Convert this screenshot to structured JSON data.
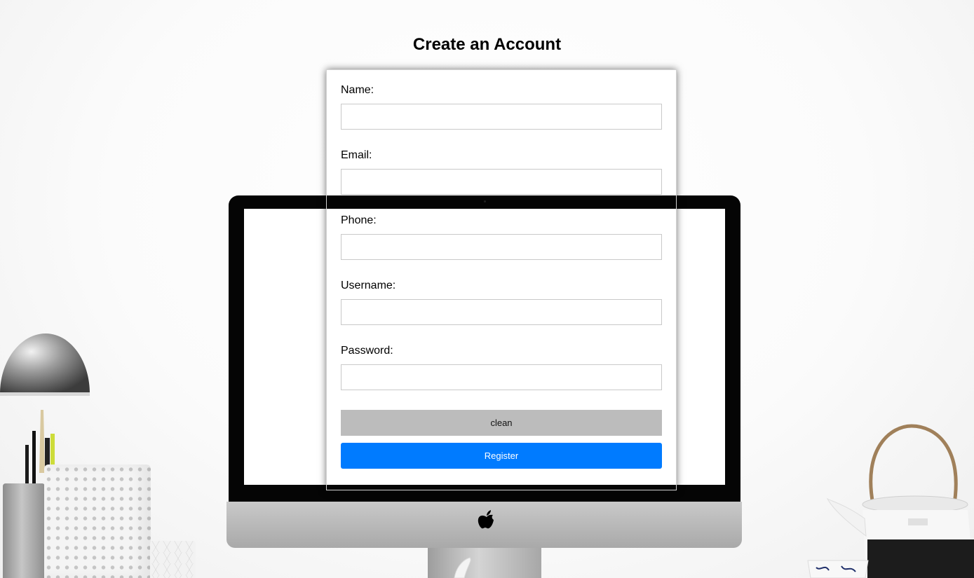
{
  "page": {
    "title": "Create an Account"
  },
  "form": {
    "fields": [
      {
        "label": "Name:",
        "value": "",
        "placeholder": ""
      },
      {
        "label": "Email:",
        "value": "",
        "placeholder": ""
      },
      {
        "label": "Phone:",
        "value": "",
        "placeholder": ""
      },
      {
        "label": "Username:",
        "value": "",
        "placeholder": ""
      },
      {
        "label": "Password:",
        "value": "",
        "placeholder": ""
      }
    ],
    "clean_label": "clean",
    "register_label": "Register"
  },
  "background": {
    "objects": [
      "desk-lamp",
      "pencil-holder",
      "imac",
      "apple-logo-icon",
      "teapot",
      "cup"
    ]
  },
  "colors": {
    "register_button": "#007bff",
    "clean_button": "#bcbcbc",
    "title_text": "#000000"
  }
}
